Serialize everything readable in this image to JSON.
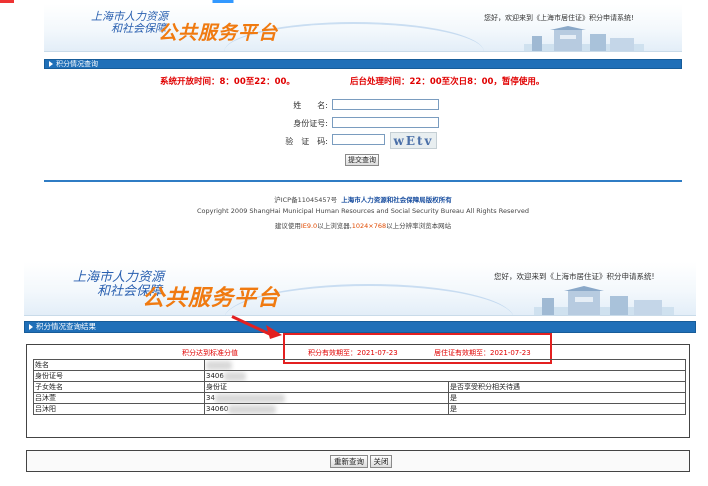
{
  "top_panel": {
    "logo": {
      "line1": "上海市人力资源",
      "line2": "和社会保障",
      "big": "公共服务平台"
    },
    "welcome": "您好，欢迎来到《上海市居住证》积分申请系统!",
    "section_title": "积分情况查询",
    "notice_open": "系统开放时间：8：00至22：00。",
    "notice_process": "后台处理时间：22：00至次日8：00，暂停使用。",
    "form": {
      "name_label": "姓　　名:",
      "id_label": "身份证号:",
      "captcha_label": "验　证　码:",
      "captcha_text": "wEtv",
      "name_value": "",
      "id_value": "",
      "captcha_value": ""
    },
    "submit_label": "提交查询",
    "footer": {
      "icp": "沪ICP备11045457号",
      "owner": "上海市人力资源和社会保障局版权所有",
      "copyright": "Copyright 2009 ShangHai Municipal Human Resources and Social Security Bureau All Rights Reserved",
      "suggest_prefix": "建议使用",
      "suggest_ie": "IE9.0",
      "suggest_mid": "以上浏览器,",
      "suggest_res": "1024×768",
      "suggest_suffix": "以上分辨率浏览本网站"
    }
  },
  "bottom_panel": {
    "logo": {
      "line1": "上海市人力资源",
      "line2": "和社会保障",
      "big": "公共服务平台"
    },
    "welcome": "您好，欢迎来到《上海市居住证》积分申请系统!",
    "section_title": "积分情况查询结果",
    "status_score": "积分达到标准分值",
    "status_valid": "积分有效期至：2021-07-23",
    "status_residence": "居住证有效期至：2021-07-23",
    "rows": [
      {
        "label": "姓名",
        "value": ""
      },
      {
        "label": "身份证号",
        "value": "3406"
      }
    ],
    "child_header": {
      "name": "子女姓名",
      "id": "身份证",
      "benefit": "是否享受积分相关待遇"
    },
    "children": [
      {
        "name": "吕沐萱",
        "id": "34",
        "benefit": "是"
      },
      {
        "name": "吕沐阳",
        "id": "34060",
        "benefit": "是"
      }
    ],
    "requery_label": "重新查询",
    "close_label": "关闭"
  }
}
